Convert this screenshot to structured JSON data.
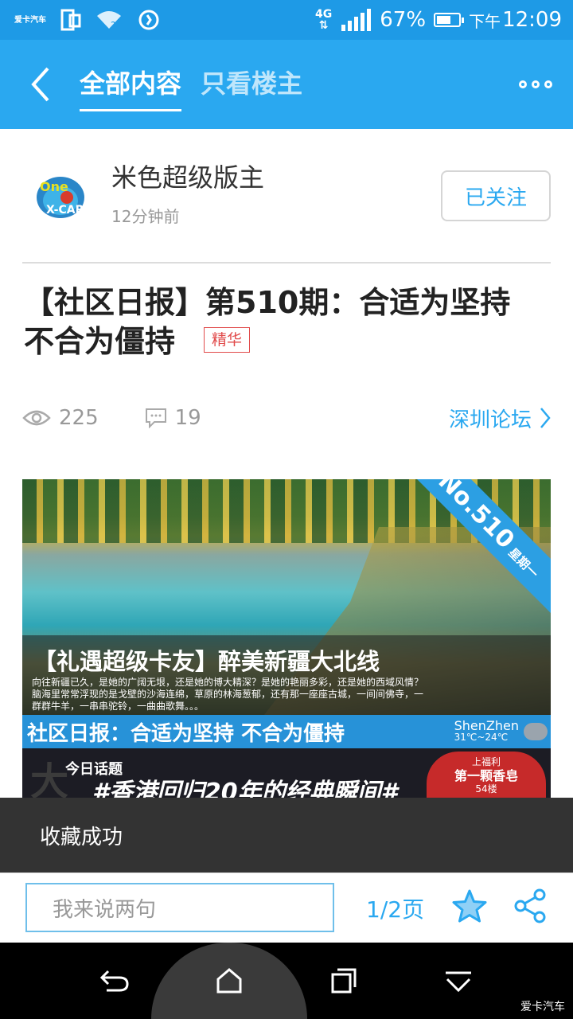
{
  "status_bar": {
    "app_logo": "爱卡汽车",
    "network": "4G",
    "battery": "67%",
    "battery_level": 0.67,
    "time_period": "下午",
    "time": "12:09"
  },
  "nav": {
    "tab_all": "全部内容",
    "tab_op_only": "只看楼主",
    "back_icon": "chevron-left-icon",
    "more_icon": "more-icon"
  },
  "author": {
    "name": "米色超级版主",
    "time_ago": "12分钟前",
    "follow_label": "已关注"
  },
  "post": {
    "title": "【社区日报】第510期：合适为坚持 不合为僵持",
    "badge": "精华",
    "views": "225",
    "comments": "19",
    "forum": "深圳论坛"
  },
  "banner": {
    "ribbon_no": "No.510",
    "ribbon_day": "星期一",
    "headline": "【礼遇超级卡友】醉美新疆大北线",
    "description": "向往新疆已久，是她的广阔无垠，还是她的博大精深？是她的艳丽多彩，还是她的西域风情？脑海里常常浮现的是戈壁的沙海连绵，草原的林海葱郁，还有那一座座古城，一间间佛寺，一群群牛羊，一串串驼铃，一曲曲歌舞。。。",
    "daily_title": "社区日报：合适为坚持 不合为僵持",
    "weather_city": "ShenZhen",
    "weather_temp": "31℃~24℃",
    "topic_label": "今日话题",
    "topic_text": "#香港回归20年的经典瞬间#",
    "topic_badge_line1": "上福利",
    "topic_badge_line2": "第一颗香皂",
    "topic_badge_line3": "54楼"
  },
  "toast": {
    "message": "收藏成功"
  },
  "bottom_bar": {
    "comment_placeholder": "我来说两句",
    "page_indicator": "1/2页"
  },
  "watermark": "爱卡汽车",
  "colors": {
    "accent": "#2aa8f0",
    "status_bar": "#1e9ae6",
    "badge_red": "#e14b4b",
    "toast_bg": "#333333"
  }
}
